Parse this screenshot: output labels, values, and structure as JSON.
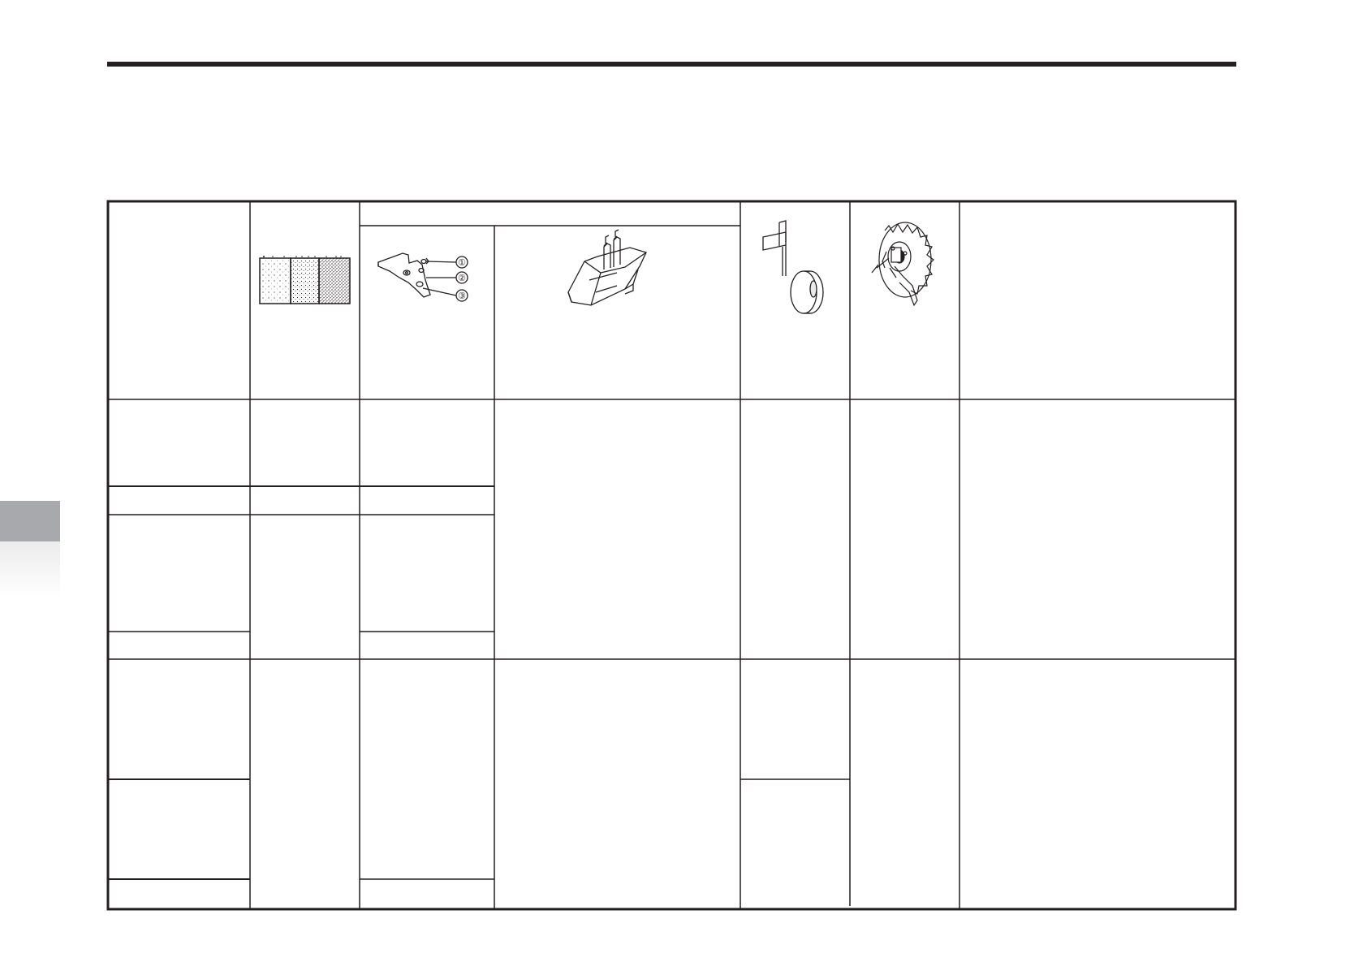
{
  "page": {
    "title": "",
    "side_tab": {
      "color": "#a7a9ac"
    }
  },
  "table": {
    "headers": {
      "col1": "",
      "col2": "",
      "col3_group": "",
      "col3a": "",
      "col3b": "",
      "col4": "",
      "col5": "",
      "col6": ""
    },
    "illustrations": {
      "soil_panel": {
        "icon": "soil-texture-samples"
      },
      "bracket": {
        "icon": "depth-bracket-icon",
        "labels": [
          "①",
          "②",
          "③"
        ]
      },
      "lever_box": {
        "icon": "control-lever-icon"
      },
      "gauge_wheel": {
        "icon": "gauge-wheel-icon"
      },
      "tire_tine": {
        "icon": "tire-tine-icon"
      }
    },
    "rows": []
  }
}
